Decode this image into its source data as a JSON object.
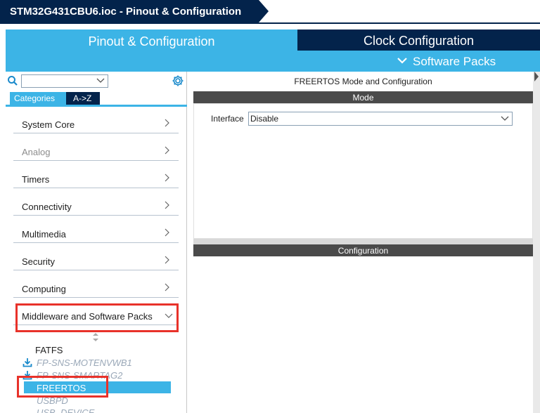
{
  "window": {
    "title": "STM32G431CBU6.ioc - Pinout & Configuration"
  },
  "tabs": {
    "pinout": "Pinout & Configuration",
    "clock": "Clock Configuration",
    "software_packs": "Software Packs"
  },
  "left": {
    "search": {
      "value": "",
      "placeholder": ""
    },
    "tabs": {
      "categories": "Categories",
      "az": "A->Z"
    },
    "categories": [
      {
        "label": "System Core",
        "enabled": true
      },
      {
        "label": "Analog",
        "enabled": false
      },
      {
        "label": "Timers",
        "enabled": true
      },
      {
        "label": "Connectivity",
        "enabled": true
      },
      {
        "label": "Multimedia",
        "enabled": true
      },
      {
        "label": "Security",
        "enabled": true
      },
      {
        "label": "Computing",
        "enabled": true
      },
      {
        "label": "Middleware and Software Packs",
        "enabled": true,
        "expanded": true
      }
    ],
    "middleware_items": [
      {
        "label": "FATFS",
        "dim": false
      },
      {
        "label": "FP-SNS-MOTENVWB1",
        "dim": true,
        "icon": "download-icon"
      },
      {
        "label": "FP-SNS-SMARTAG2",
        "dim": true,
        "icon": "download-icon"
      },
      {
        "label": "FREERTOS",
        "selected": true
      },
      {
        "label": "USBPD",
        "dim": true
      },
      {
        "label": "USB_DEVICE",
        "dim": true
      }
    ]
  },
  "right": {
    "title": "FREERTOS Mode and Configuration",
    "mode_header": "Mode",
    "interface_label": "Interface",
    "interface_value": "Disable",
    "config_header": "Configuration"
  },
  "colors": {
    "navy": "#03234b",
    "accent": "#3cb4e6",
    "highlight": "#e8322a"
  }
}
